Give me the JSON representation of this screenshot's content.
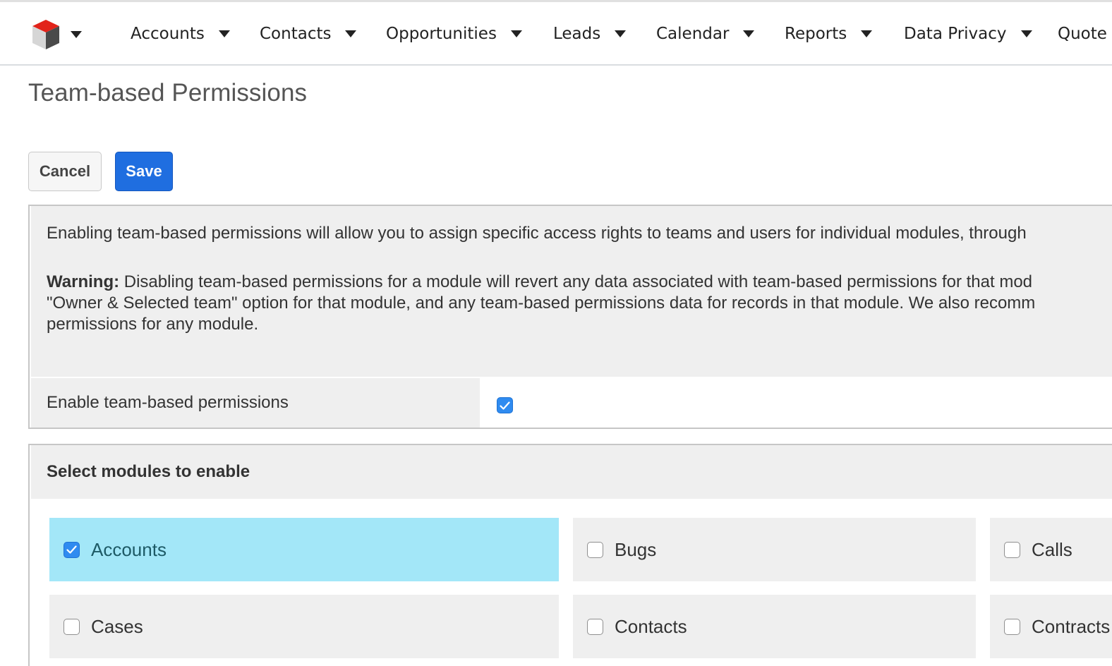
{
  "nav": {
    "logo_icon": "sugar-cube-icon",
    "items": [
      {
        "label": "Accounts"
      },
      {
        "label": "Contacts"
      },
      {
        "label": "Opportunities"
      },
      {
        "label": "Leads"
      },
      {
        "label": "Calendar"
      },
      {
        "label": "Reports"
      },
      {
        "label": "Data Privacy"
      },
      {
        "label": "Quote"
      }
    ]
  },
  "page": {
    "title": "Team-based Permissions"
  },
  "actions": {
    "cancel_label": "Cancel",
    "save_label": "Save"
  },
  "info": {
    "description": "Enabling team-based permissions will allow you to assign specific access rights to teams and users for individual modules, through",
    "warning_label": "Warning:",
    "warning_line1": " Disabling team-based permissions for a module will revert any data associated with team-based permissions for that mod",
    "warning_line2": "\"Owner & Selected team\" option for that module, and any team-based permissions data for records in that module. We also recomm",
    "warning_line3": "permissions for any module."
  },
  "enable": {
    "label": "Enable team-based permissions",
    "checked": true
  },
  "modules": {
    "header": "Select modules to enable",
    "items": [
      {
        "label": "Accounts",
        "checked": true
      },
      {
        "label": "Bugs",
        "checked": false
      },
      {
        "label": "Calls",
        "checked": false
      },
      {
        "label": "Cases",
        "checked": false
      },
      {
        "label": "Contacts",
        "checked": false
      },
      {
        "label": "Contracts",
        "checked": false
      }
    ]
  },
  "colors": {
    "primary": "#1f6ee0",
    "selected_row": "#a3e7f8",
    "panel_bg": "#efefef",
    "checkbox_checked": "#2f8bf0",
    "logo_red": "#e2231a"
  }
}
